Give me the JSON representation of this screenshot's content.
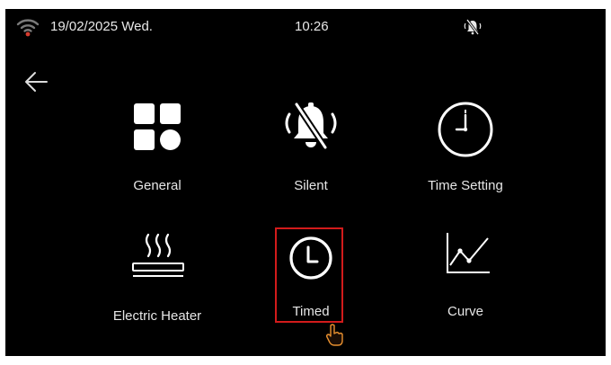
{
  "status_bar": {
    "date": "19/02/2025 Wed.",
    "time": "10:26",
    "wifi_icon": "wifi-icon",
    "wifi_color": "#d63b2f",
    "mute_icon": "bell-muted-icon"
  },
  "navigation": {
    "back_icon": "arrow-left-icon"
  },
  "menu": {
    "items": [
      {
        "label": "General",
        "icon": "grid-icon"
      },
      {
        "label": "Silent",
        "icon": "bell-muted-icon"
      },
      {
        "label": "Time Setting",
        "icon": "clock-icon"
      },
      {
        "label": "Electric Heater",
        "icon": "heater-icon"
      },
      {
        "label": "Timed",
        "icon": "timer-icon",
        "selected": true
      },
      {
        "label": "Curve",
        "icon": "curve-chart-icon"
      }
    ]
  },
  "colors": {
    "background": "#000000",
    "foreground": "#ffffff",
    "selection_border": "#d21b1b",
    "cursor": "#e8902f"
  }
}
